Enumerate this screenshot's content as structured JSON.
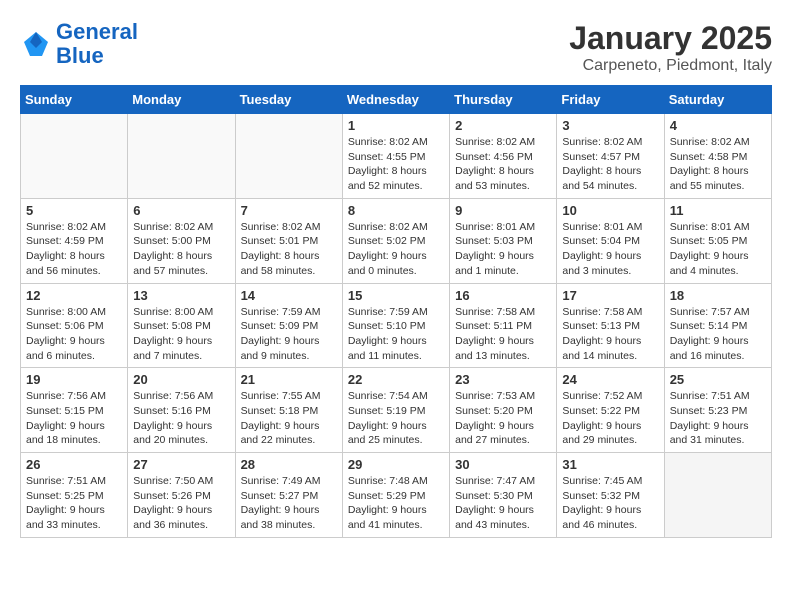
{
  "header": {
    "logo_line1": "General",
    "logo_line2": "Blue",
    "month": "January 2025",
    "location": "Carpeneto, Piedmont, Italy"
  },
  "days_of_week": [
    "Sunday",
    "Monday",
    "Tuesday",
    "Wednesday",
    "Thursday",
    "Friday",
    "Saturday"
  ],
  "weeks": [
    [
      {
        "day": "",
        "info": ""
      },
      {
        "day": "",
        "info": ""
      },
      {
        "day": "",
        "info": ""
      },
      {
        "day": "1",
        "info": "Sunrise: 8:02 AM\nSunset: 4:55 PM\nDaylight: 8 hours and 52 minutes."
      },
      {
        "day": "2",
        "info": "Sunrise: 8:02 AM\nSunset: 4:56 PM\nDaylight: 8 hours and 53 minutes."
      },
      {
        "day": "3",
        "info": "Sunrise: 8:02 AM\nSunset: 4:57 PM\nDaylight: 8 hours and 54 minutes."
      },
      {
        "day": "4",
        "info": "Sunrise: 8:02 AM\nSunset: 4:58 PM\nDaylight: 8 hours and 55 minutes."
      }
    ],
    [
      {
        "day": "5",
        "info": "Sunrise: 8:02 AM\nSunset: 4:59 PM\nDaylight: 8 hours and 56 minutes."
      },
      {
        "day": "6",
        "info": "Sunrise: 8:02 AM\nSunset: 5:00 PM\nDaylight: 8 hours and 57 minutes."
      },
      {
        "day": "7",
        "info": "Sunrise: 8:02 AM\nSunset: 5:01 PM\nDaylight: 8 hours and 58 minutes."
      },
      {
        "day": "8",
        "info": "Sunrise: 8:02 AM\nSunset: 5:02 PM\nDaylight: 9 hours and 0 minutes."
      },
      {
        "day": "9",
        "info": "Sunrise: 8:01 AM\nSunset: 5:03 PM\nDaylight: 9 hours and 1 minute."
      },
      {
        "day": "10",
        "info": "Sunrise: 8:01 AM\nSunset: 5:04 PM\nDaylight: 9 hours and 3 minutes."
      },
      {
        "day": "11",
        "info": "Sunrise: 8:01 AM\nSunset: 5:05 PM\nDaylight: 9 hours and 4 minutes."
      }
    ],
    [
      {
        "day": "12",
        "info": "Sunrise: 8:00 AM\nSunset: 5:06 PM\nDaylight: 9 hours and 6 minutes."
      },
      {
        "day": "13",
        "info": "Sunrise: 8:00 AM\nSunset: 5:08 PM\nDaylight: 9 hours and 7 minutes."
      },
      {
        "day": "14",
        "info": "Sunrise: 7:59 AM\nSunset: 5:09 PM\nDaylight: 9 hours and 9 minutes."
      },
      {
        "day": "15",
        "info": "Sunrise: 7:59 AM\nSunset: 5:10 PM\nDaylight: 9 hours and 11 minutes."
      },
      {
        "day": "16",
        "info": "Sunrise: 7:58 AM\nSunset: 5:11 PM\nDaylight: 9 hours and 13 minutes."
      },
      {
        "day": "17",
        "info": "Sunrise: 7:58 AM\nSunset: 5:13 PM\nDaylight: 9 hours and 14 minutes."
      },
      {
        "day": "18",
        "info": "Sunrise: 7:57 AM\nSunset: 5:14 PM\nDaylight: 9 hours and 16 minutes."
      }
    ],
    [
      {
        "day": "19",
        "info": "Sunrise: 7:56 AM\nSunset: 5:15 PM\nDaylight: 9 hours and 18 minutes."
      },
      {
        "day": "20",
        "info": "Sunrise: 7:56 AM\nSunset: 5:16 PM\nDaylight: 9 hours and 20 minutes."
      },
      {
        "day": "21",
        "info": "Sunrise: 7:55 AM\nSunset: 5:18 PM\nDaylight: 9 hours and 22 minutes."
      },
      {
        "day": "22",
        "info": "Sunrise: 7:54 AM\nSunset: 5:19 PM\nDaylight: 9 hours and 25 minutes."
      },
      {
        "day": "23",
        "info": "Sunrise: 7:53 AM\nSunset: 5:20 PM\nDaylight: 9 hours and 27 minutes."
      },
      {
        "day": "24",
        "info": "Sunrise: 7:52 AM\nSunset: 5:22 PM\nDaylight: 9 hours and 29 minutes."
      },
      {
        "day": "25",
        "info": "Sunrise: 7:51 AM\nSunset: 5:23 PM\nDaylight: 9 hours and 31 minutes."
      }
    ],
    [
      {
        "day": "26",
        "info": "Sunrise: 7:51 AM\nSunset: 5:25 PM\nDaylight: 9 hours and 33 minutes."
      },
      {
        "day": "27",
        "info": "Sunrise: 7:50 AM\nSunset: 5:26 PM\nDaylight: 9 hours and 36 minutes."
      },
      {
        "day": "28",
        "info": "Sunrise: 7:49 AM\nSunset: 5:27 PM\nDaylight: 9 hours and 38 minutes."
      },
      {
        "day": "29",
        "info": "Sunrise: 7:48 AM\nSunset: 5:29 PM\nDaylight: 9 hours and 41 minutes."
      },
      {
        "day": "30",
        "info": "Sunrise: 7:47 AM\nSunset: 5:30 PM\nDaylight: 9 hours and 43 minutes."
      },
      {
        "day": "31",
        "info": "Sunrise: 7:45 AM\nSunset: 5:32 PM\nDaylight: 9 hours and 46 minutes."
      },
      {
        "day": "",
        "info": ""
      }
    ]
  ]
}
